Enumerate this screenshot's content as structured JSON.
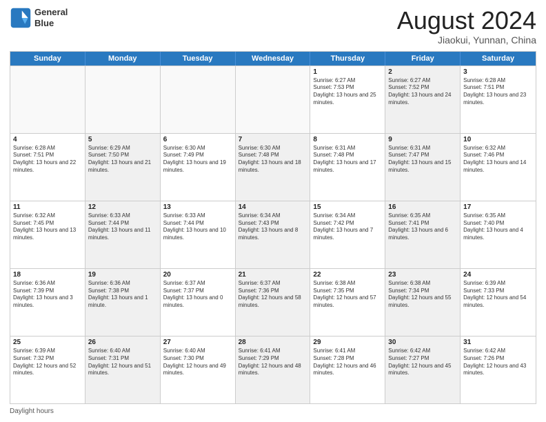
{
  "header": {
    "logo_line1": "General",
    "logo_line2": "Blue",
    "month_title": "August 2024",
    "location": "Jiaokui, Yunnan, China"
  },
  "days_of_week": [
    "Sunday",
    "Monday",
    "Tuesday",
    "Wednesday",
    "Thursday",
    "Friday",
    "Saturday"
  ],
  "footer_text": "Daylight hours",
  "weeks": [
    [
      {
        "day": "",
        "text": "",
        "shaded": false,
        "empty": true
      },
      {
        "day": "",
        "text": "",
        "shaded": false,
        "empty": true
      },
      {
        "day": "",
        "text": "",
        "shaded": false,
        "empty": true
      },
      {
        "day": "",
        "text": "",
        "shaded": false,
        "empty": true
      },
      {
        "day": "1",
        "text": "Sunrise: 6:27 AM\nSunset: 7:53 PM\nDaylight: 13 hours and 25 minutes.",
        "shaded": false,
        "empty": false
      },
      {
        "day": "2",
        "text": "Sunrise: 6:27 AM\nSunset: 7:52 PM\nDaylight: 13 hours and 24 minutes.",
        "shaded": true,
        "empty": false
      },
      {
        "day": "3",
        "text": "Sunrise: 6:28 AM\nSunset: 7:51 PM\nDaylight: 13 hours and 23 minutes.",
        "shaded": false,
        "empty": false
      }
    ],
    [
      {
        "day": "4",
        "text": "Sunrise: 6:28 AM\nSunset: 7:51 PM\nDaylight: 13 hours and 22 minutes.",
        "shaded": false,
        "empty": false
      },
      {
        "day": "5",
        "text": "Sunrise: 6:29 AM\nSunset: 7:50 PM\nDaylight: 13 hours and 21 minutes.",
        "shaded": true,
        "empty": false
      },
      {
        "day": "6",
        "text": "Sunrise: 6:30 AM\nSunset: 7:49 PM\nDaylight: 13 hours and 19 minutes.",
        "shaded": false,
        "empty": false
      },
      {
        "day": "7",
        "text": "Sunrise: 6:30 AM\nSunset: 7:48 PM\nDaylight: 13 hours and 18 minutes.",
        "shaded": true,
        "empty": false
      },
      {
        "day": "8",
        "text": "Sunrise: 6:31 AM\nSunset: 7:48 PM\nDaylight: 13 hours and 17 minutes.",
        "shaded": false,
        "empty": false
      },
      {
        "day": "9",
        "text": "Sunrise: 6:31 AM\nSunset: 7:47 PM\nDaylight: 13 hours and 15 minutes.",
        "shaded": true,
        "empty": false
      },
      {
        "day": "10",
        "text": "Sunrise: 6:32 AM\nSunset: 7:46 PM\nDaylight: 13 hours and 14 minutes.",
        "shaded": false,
        "empty": false
      }
    ],
    [
      {
        "day": "11",
        "text": "Sunrise: 6:32 AM\nSunset: 7:45 PM\nDaylight: 13 hours and 13 minutes.",
        "shaded": false,
        "empty": false
      },
      {
        "day": "12",
        "text": "Sunrise: 6:33 AM\nSunset: 7:44 PM\nDaylight: 13 hours and 11 minutes.",
        "shaded": true,
        "empty": false
      },
      {
        "day": "13",
        "text": "Sunrise: 6:33 AM\nSunset: 7:44 PM\nDaylight: 13 hours and 10 minutes.",
        "shaded": false,
        "empty": false
      },
      {
        "day": "14",
        "text": "Sunrise: 6:34 AM\nSunset: 7:43 PM\nDaylight: 13 hours and 8 minutes.",
        "shaded": true,
        "empty": false
      },
      {
        "day": "15",
        "text": "Sunrise: 6:34 AM\nSunset: 7:42 PM\nDaylight: 13 hours and 7 minutes.",
        "shaded": false,
        "empty": false
      },
      {
        "day": "16",
        "text": "Sunrise: 6:35 AM\nSunset: 7:41 PM\nDaylight: 13 hours and 6 minutes.",
        "shaded": true,
        "empty": false
      },
      {
        "day": "17",
        "text": "Sunrise: 6:35 AM\nSunset: 7:40 PM\nDaylight: 13 hours and 4 minutes.",
        "shaded": false,
        "empty": false
      }
    ],
    [
      {
        "day": "18",
        "text": "Sunrise: 6:36 AM\nSunset: 7:39 PM\nDaylight: 13 hours and 3 minutes.",
        "shaded": false,
        "empty": false
      },
      {
        "day": "19",
        "text": "Sunrise: 6:36 AM\nSunset: 7:38 PM\nDaylight: 13 hours and 1 minute.",
        "shaded": true,
        "empty": false
      },
      {
        "day": "20",
        "text": "Sunrise: 6:37 AM\nSunset: 7:37 PM\nDaylight: 13 hours and 0 minutes.",
        "shaded": false,
        "empty": false
      },
      {
        "day": "21",
        "text": "Sunrise: 6:37 AM\nSunset: 7:36 PM\nDaylight: 12 hours and 58 minutes.",
        "shaded": true,
        "empty": false
      },
      {
        "day": "22",
        "text": "Sunrise: 6:38 AM\nSunset: 7:35 PM\nDaylight: 12 hours and 57 minutes.",
        "shaded": false,
        "empty": false
      },
      {
        "day": "23",
        "text": "Sunrise: 6:38 AM\nSunset: 7:34 PM\nDaylight: 12 hours and 55 minutes.",
        "shaded": true,
        "empty": false
      },
      {
        "day": "24",
        "text": "Sunrise: 6:39 AM\nSunset: 7:33 PM\nDaylight: 12 hours and 54 minutes.",
        "shaded": false,
        "empty": false
      }
    ],
    [
      {
        "day": "25",
        "text": "Sunrise: 6:39 AM\nSunset: 7:32 PM\nDaylight: 12 hours and 52 minutes.",
        "shaded": false,
        "empty": false
      },
      {
        "day": "26",
        "text": "Sunrise: 6:40 AM\nSunset: 7:31 PM\nDaylight: 12 hours and 51 minutes.",
        "shaded": true,
        "empty": false
      },
      {
        "day": "27",
        "text": "Sunrise: 6:40 AM\nSunset: 7:30 PM\nDaylight: 12 hours and 49 minutes.",
        "shaded": false,
        "empty": false
      },
      {
        "day": "28",
        "text": "Sunrise: 6:41 AM\nSunset: 7:29 PM\nDaylight: 12 hours and 48 minutes.",
        "shaded": true,
        "empty": false
      },
      {
        "day": "29",
        "text": "Sunrise: 6:41 AM\nSunset: 7:28 PM\nDaylight: 12 hours and 46 minutes.",
        "shaded": false,
        "empty": false
      },
      {
        "day": "30",
        "text": "Sunrise: 6:42 AM\nSunset: 7:27 PM\nDaylight: 12 hours and 45 minutes.",
        "shaded": true,
        "empty": false
      },
      {
        "day": "31",
        "text": "Sunrise: 6:42 AM\nSunset: 7:26 PM\nDaylight: 12 hours and 43 minutes.",
        "shaded": false,
        "empty": false
      }
    ]
  ]
}
